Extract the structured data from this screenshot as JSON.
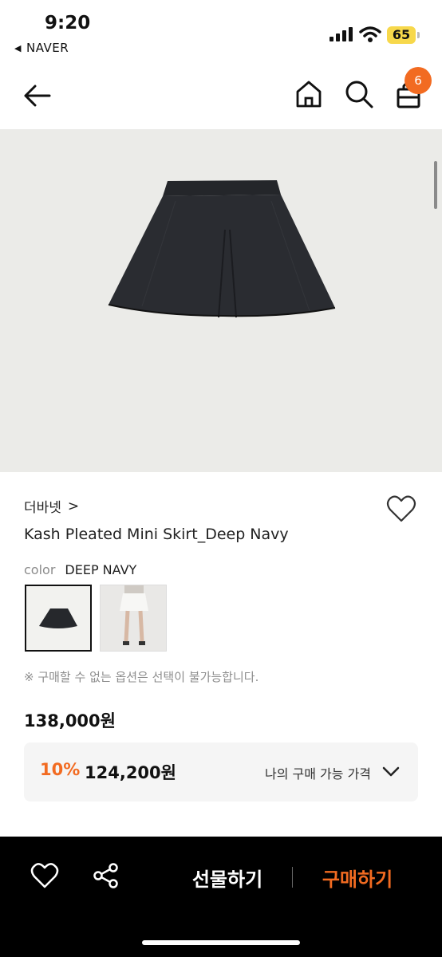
{
  "status": {
    "time": "9:20",
    "back_app": "NAVER",
    "battery": "65"
  },
  "nav": {
    "cart_count": "6"
  },
  "product": {
    "brand": "더바넷",
    "brand_chevron": ">",
    "name": "Kash Pleated Mini Skirt_Deep Navy",
    "color_label": "color",
    "color_value": "DEEP NAVY",
    "notice": "※ 구매할 수 없는 옵션은 선택이 불가능합니다.",
    "price": "138,000원",
    "discount_rate": "10%",
    "discounted_price": "124,200원",
    "my_price_label": "나의 구매 가능 가격"
  },
  "bottom": {
    "gift_label": "선물하기",
    "buy_label": "구매하기"
  },
  "colors": {
    "accent": "#f26b21",
    "hero_bg": "#ebebe8",
    "skirt": "#26282c"
  },
  "icons": [
    "back-arrow-icon",
    "home-icon",
    "search-icon",
    "bag-icon",
    "heart-icon",
    "share-icon",
    "chevron-down-icon"
  ]
}
